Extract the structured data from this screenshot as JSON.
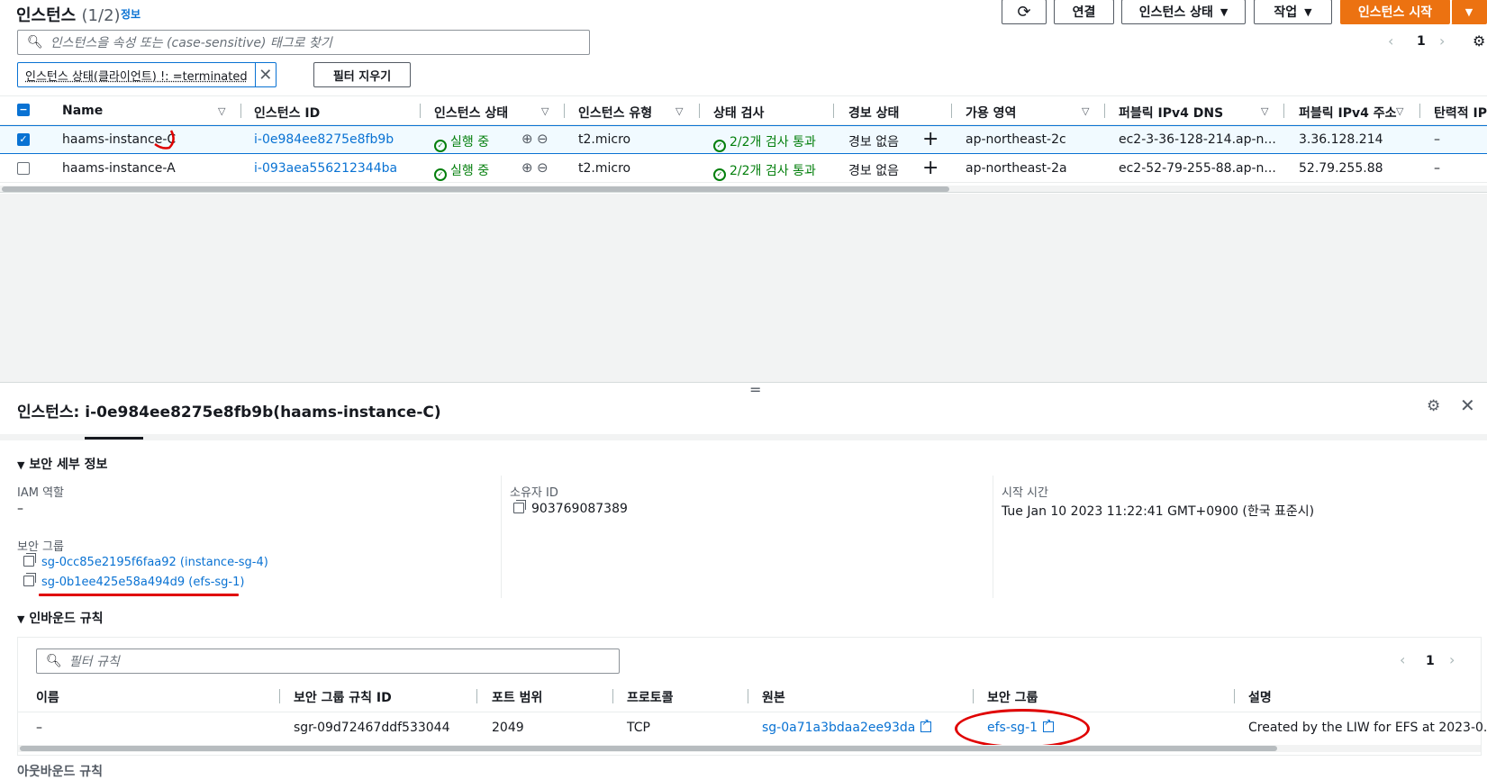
{
  "header": {
    "title": "인스턴스",
    "count": "(1/2)",
    "info": "정보",
    "buttons": {
      "connect": "연결",
      "instance_state": "인스턴스 상태",
      "actions": "작업",
      "launch": "인스턴스 시작"
    },
    "search_placeholder": "인스턴스을 속성 또는 (case-sensitive) 태그로 찾기",
    "filter_chip": "인스턴스 상태(클라이언트) !: =terminated",
    "clear_filters": "필터 지우기",
    "page": "1"
  },
  "table": {
    "columns": [
      "Name",
      "인스턴스 ID",
      "인스턴스 상태",
      "인스턴스 유형",
      "상태 검사",
      "경보 상태",
      "가용 영역",
      "퍼블릭 IPv4 DNS",
      "퍼블릭 IPv4 주소",
      "탄력적 IP"
    ],
    "rows": [
      {
        "selected": true,
        "name": "haams-instance-C",
        "id": "i-0e984ee8275e8fb9b",
        "state": "실행 중",
        "type": "t2.micro",
        "check": "2/2개 검사 통과",
        "alarm": "경보 없음",
        "az": "ap-northeast-2c",
        "dns": "ec2-3-36-128-214.ap-n...",
        "ip": "3.36.128.214",
        "eip": "–"
      },
      {
        "selected": false,
        "name": "haams-instance-A",
        "id": "i-093aea556212344ba",
        "state": "실행 중",
        "type": "t2.micro",
        "check": "2/2개 검사 통과",
        "alarm": "경보 없음",
        "az": "ap-northeast-2a",
        "dns": "ec2-52-79-255-88.ap-n...",
        "ip": "52.79.255.88",
        "eip": "–"
      }
    ]
  },
  "detail": {
    "resize_handle": "=",
    "title": "인스턴스: i-0e984ee8275e8fb9b(haams-instance-C)",
    "security_section": "보안 세부 정보",
    "iam_label": "IAM 역할",
    "iam_value": "–",
    "owner_label": "소유자 ID",
    "owner_value": "903769087389",
    "launch_label": "시작 시간",
    "launch_value": "Tue Jan 10 2023 11:22:41 GMT+0900 (한국 표준시)",
    "sg_label": "보안 그룹",
    "security_groups": [
      "sg-0cc85e2195f6faa92 (instance-sg-4)",
      "sg-0b1ee425e58a494d9 (efs-sg-1)"
    ],
    "inbound_section": "인바운드 규칙",
    "inbound_filter_placeholder": "필터 규칙",
    "inbound_page": "1",
    "inbound_columns": [
      "이름",
      "보안 그룹 규칙 ID",
      "포트 범위",
      "프로토콜",
      "원본",
      "보안 그룹",
      "설명"
    ],
    "inbound_row": {
      "name": "–",
      "rule_id": "sgr-09d72467ddf533044",
      "port": "2049",
      "protocol": "TCP",
      "source": "sg-0a71a3bdaa2ee93da",
      "sg": "efs-sg-1",
      "desc": "Created by the LIW for EFS at 2023-0..."
    },
    "outbound_section_partial": "아웃바운드 규칙"
  },
  "colors": {
    "accent": "#0972d3",
    "primary": "#ec7211",
    "success": "#037f0c",
    "annotation": "#e00000"
  }
}
